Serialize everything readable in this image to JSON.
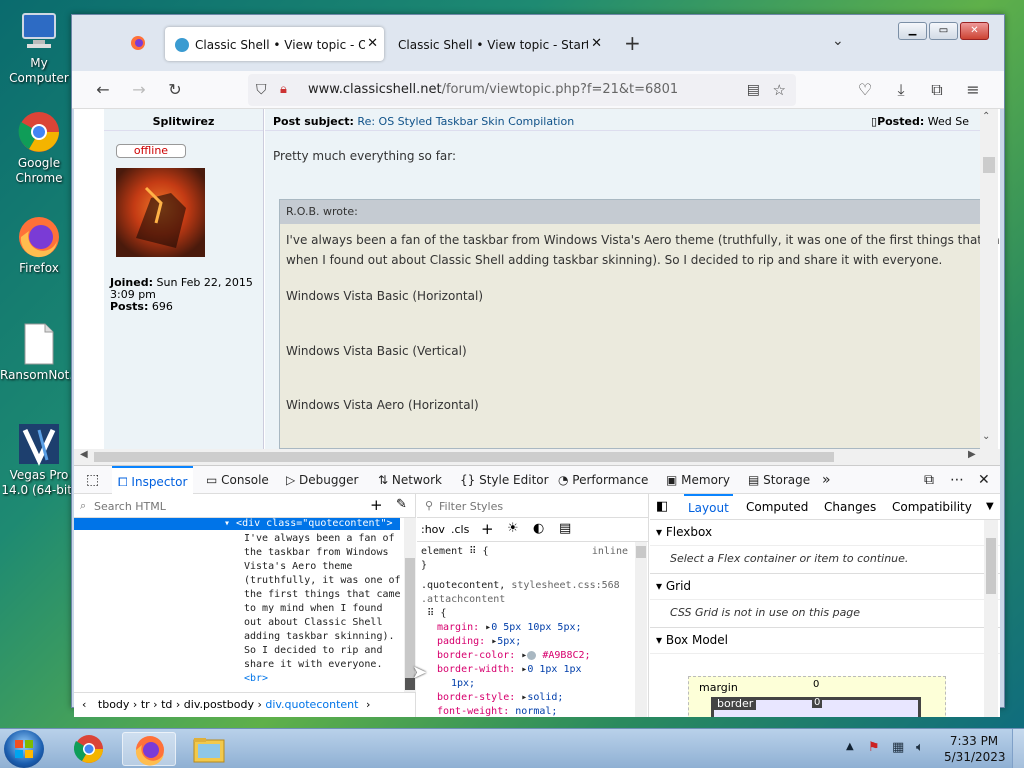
{
  "desktop": {
    "icons": [
      {
        "label": "My Computer",
        "icon": "computer-icon"
      },
      {
        "label": "Google Chrome",
        "icon": "chrome-icon"
      },
      {
        "label": "Firefox",
        "icon": "firefox-icon"
      },
      {
        "label": "RansomNot...",
        "icon": "file-icon"
      },
      {
        "label": "Vegas Pro 14.0 (64-bit)",
        "icon": "vegas-icon"
      }
    ]
  },
  "browser": {
    "tabs": [
      {
        "title": "Classic Shell • View topic - OS S",
        "active": true
      },
      {
        "title": "Classic Shell • View topic - Start Butt",
        "active": false
      }
    ],
    "new_tab": "+",
    "url_domain": "www.classicshell.net",
    "url_path": "/forum/viewtopic.php?f=21&t=6801"
  },
  "post": {
    "author": "Splitwirez",
    "status": "offline",
    "joined_label": "Joined:",
    "joined_value": "Sun Feb 22, 2015 3:09 pm",
    "posts_label": "Posts:",
    "posts_value": "696",
    "subject_label": "Post subject:",
    "subject_value": "Re: OS Styled Taskbar Skin Compilation",
    "posted_label": "Posted:",
    "posted_value": "Wed Se",
    "body": "Pretty much everything so far:",
    "quote_author": "R.O.B. wrote:",
    "quote_line1": "I've always been a fan of the taskbar from Windows Vista's Aero theme (truthfully, it was one of the first things that ca",
    "quote_line2": "when I found out about Classic Shell adding taskbar skinning). So I decided to rip and share it with everyone.",
    "items": [
      "Windows Vista Basic (Horizontal)",
      "Windows Vista Basic (Vertical)",
      "Windows Vista Aero (Horizontal)"
    ]
  },
  "devtools": {
    "tabs": [
      "Inspector",
      "Console",
      "Debugger",
      "Network",
      "Style Editor",
      "Performance",
      "Memory",
      "Storage"
    ],
    "search_placeholder": "Search HTML",
    "selected_node": "<div class=\"quotecontent\">",
    "node_text": [
      "I've always been a fan of",
      "the taskbar from Windows",
      "Vista's Aero theme",
      "(truthfully, it was one of",
      "the first things that came",
      "to my mind when I found",
      "out about Classic Shell",
      "adding taskbar skinning).",
      "So I decided to rip and",
      "share it with everyone."
    ],
    "br_tag": "<br>",
    "breadcrumbs": [
      "tbody",
      "tr",
      "td",
      "div.postbody",
      "div.quotecontent"
    ],
    "filter_placeholder": "Filter Styles",
    "hov": ":hov",
    "cls": ".cls",
    "element_rule": "element",
    "inline_label": "inline",
    "rule_selector": ".quotecontent,",
    "rule_source": "stylesheet.css:568",
    "rule_selector2": ".attachcontent",
    "declarations": [
      {
        "prop": "margin:",
        "value": "0 5px 10px 5px;"
      },
      {
        "prop": "padding:",
        "value": "5px;"
      },
      {
        "prop": "border-color:",
        "value": "#A9B8C2;"
      },
      {
        "prop": "border-width:",
        "value": "0 1px 1px"
      },
      {
        "prop": "",
        "value": "1px;"
      },
      {
        "prop": "border-style:",
        "value": "solid;"
      },
      {
        "prop": "font-weight:",
        "value": "normal;"
      }
    ],
    "layout_tabs": [
      "Layout",
      "Computed",
      "Changes",
      "Compatibility"
    ],
    "sections": [
      {
        "title": "Flexbox",
        "note": "Select a Flex container or item to continue."
      },
      {
        "title": "Grid",
        "note": "CSS Grid is not in use on this page"
      },
      {
        "title": "Box Model",
        "note": ""
      }
    ],
    "box_margin": "margin",
    "box_border": "border",
    "box_zero": "0"
  },
  "taskbar": {
    "time": "7:33 PM",
    "date": "5/31/2023"
  }
}
